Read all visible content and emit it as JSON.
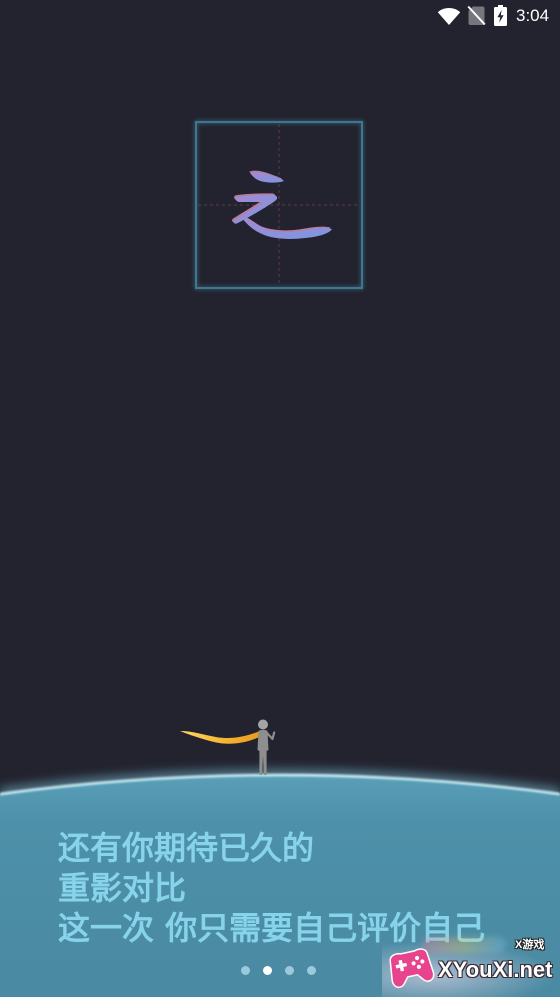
{
  "status_bar": {
    "time": "3:04",
    "icons": {
      "wifi": "wifi-icon",
      "sim": "no-sim-icon",
      "battery": "battery-charging-icon"
    }
  },
  "hero": {
    "calligraphy_character": "之"
  },
  "illustration": {
    "figure_icon": "person-with-scarf-icon",
    "planet_icon": "planet-horizon-icon"
  },
  "intro": {
    "lines": [
      "还有你期待已久的",
      "重影对比",
      "这一次 你只需要自己评价自己"
    ]
  },
  "pager": {
    "pages": 4,
    "current": 2
  },
  "watermark": {
    "logo_icon": "gamepad-logo-icon",
    "badge": "X游戏",
    "site": "XYouXi.net"
  },
  "colors": {
    "background": "#22232f",
    "planet": "#4b8ea7",
    "planet_rim": "#d6f6ff",
    "intro_text": "#86d3ea",
    "box_border": "#3e7890",
    "ink": "#8f90da",
    "ink_ghost": "#d28db4",
    "scarf": "#f4b12c",
    "figure": "#8e8e8e",
    "dot_active": "#ffffff",
    "dot_inactive": "#9ccadc",
    "watermark_logo": "#e8448e"
  }
}
